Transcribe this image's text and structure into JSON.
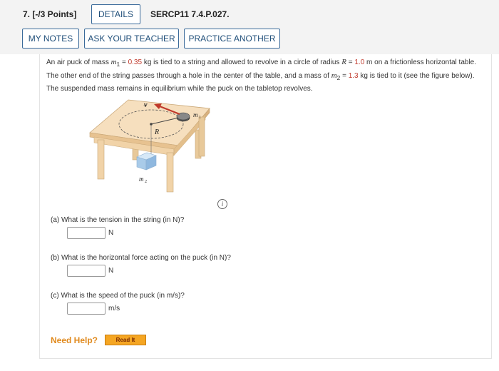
{
  "header": {
    "question_number": "7.  [-/3 Points]",
    "details_label": "DETAILS",
    "problem_id": "SERCP11 7.4.P.027.",
    "my_notes_label": "MY NOTES",
    "ask_teacher_label": "ASK YOUR TEACHER",
    "practice_label": "PRACTICE ANOTHER"
  },
  "problem": {
    "t1": "An air puck of mass ",
    "m1_sym": "m",
    "m1_sub": "1",
    "t2": " = ",
    "m1_value": "0.35",
    "t3": " kg is tied to a string and allowed to revolve in a circle of radius ",
    "R_sym": "R",
    "t4": " = ",
    "R_value": "1.0",
    "t5": " m on a frictionless horizontal table. The other end of the string passes through a hole in the center of the table, and a mass of ",
    "m2_sym": "m",
    "m2_sub": "2",
    "t6": " = ",
    "m2_value": "1.3",
    "t7": " kg is tied to it (see the figure below). The suspended mass remains in equilibrium while the puck on the tabletop revolves."
  },
  "figure": {
    "label_v": "v",
    "label_R": "R",
    "label_m1": "m",
    "label_m1_sub": "1",
    "label_m2": "m",
    "label_m2_sub": "2",
    "info_icon_text": "i"
  },
  "parts": [
    {
      "label": "(a)   What is the tension in the string (in N)?",
      "value": "",
      "unit": "N"
    },
    {
      "label": "(b)   What is the horizontal force acting on the puck (in N)?",
      "value": "",
      "unit": "N"
    },
    {
      "label": "(c)   What is the speed of the puck (in m/s)?",
      "value": "",
      "unit": "m/s"
    }
  ],
  "help": {
    "need_help_label": "Need Help?",
    "read_it_label": "Read It"
  },
  "colors": {
    "given_value": "#c0392b",
    "button_border": "#3a6a9a",
    "need_help": "#e08a1e",
    "read_it_bg": "#f5a623"
  }
}
